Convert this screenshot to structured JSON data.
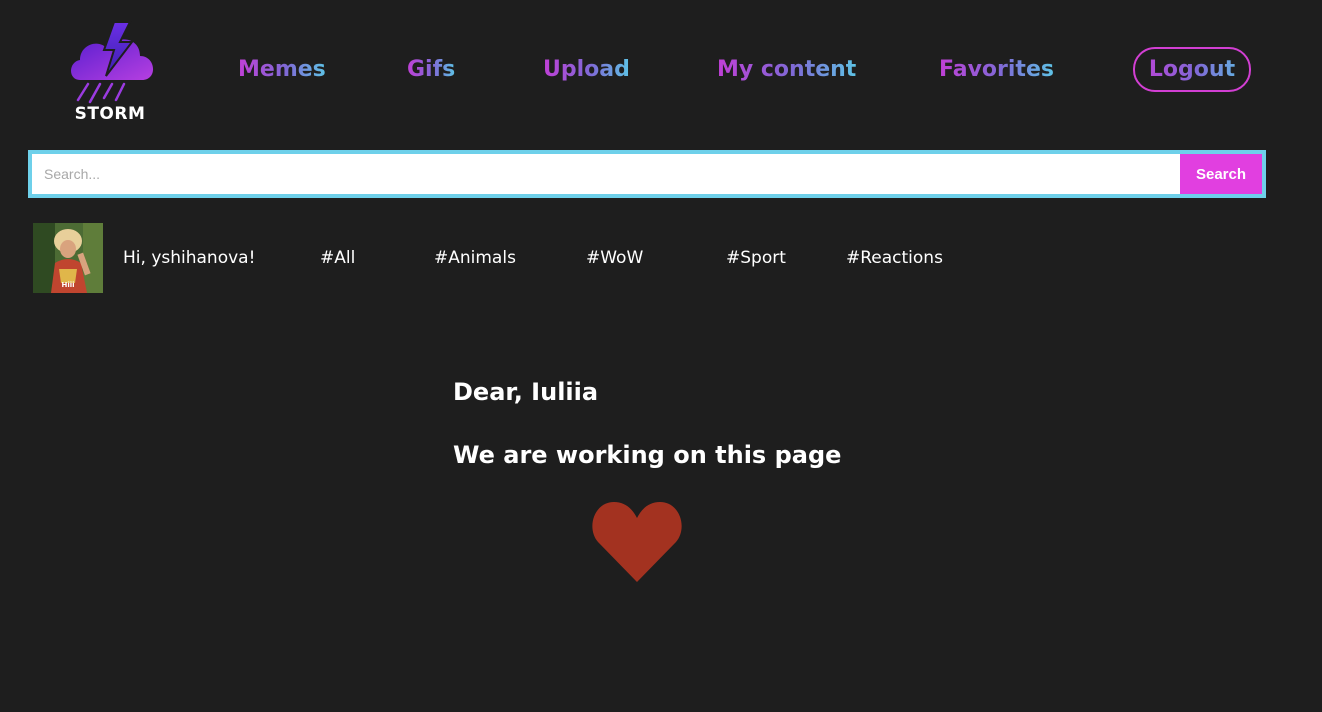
{
  "logo": {
    "text": "STORM",
    "icon": "storm-cloud-lightning-icon"
  },
  "nav": {
    "items": [
      {
        "label": "Memes"
      },
      {
        "label": "Gifs"
      },
      {
        "label": "Upload"
      },
      {
        "label": "My content"
      },
      {
        "label": "Favorites"
      }
    ],
    "logout_label": "Logout"
  },
  "search": {
    "placeholder": "Search...",
    "value": "",
    "button_label": "Search"
  },
  "user": {
    "greeting": "Hi, yshihanova!",
    "avatar_caption": "Hiii"
  },
  "tags": [
    "#All",
    "#Animals",
    "#WoW",
    "#Sport",
    "#Reactions"
  ],
  "message": {
    "line1": "Dear, Iuliia",
    "line2": "We are working on this page",
    "icon": "heart-icon"
  },
  "colors": {
    "background": "#1e1e1e",
    "nav_gradient_start": "#c03fd6",
    "nav_gradient_end": "#5ec3e6",
    "search_border": "#6ed0ea",
    "search_button": "#e13fe0",
    "logout_border": "#d23fd3",
    "heart": "#a33220"
  }
}
